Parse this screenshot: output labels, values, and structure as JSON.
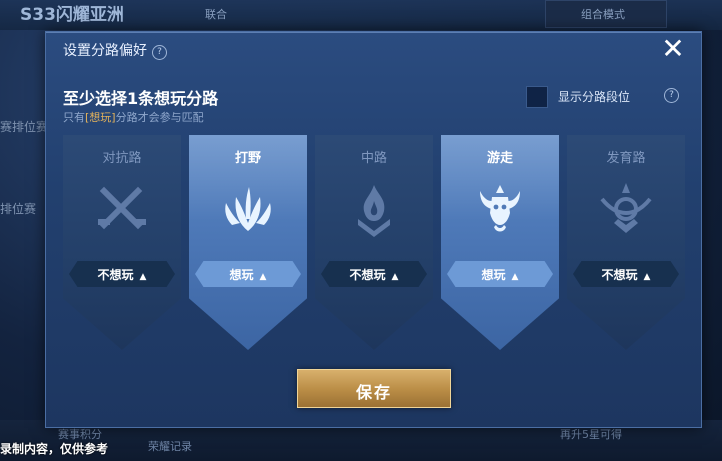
{
  "background": {
    "season_title": "S33闪耀亚洲",
    "tag": "联合",
    "left_labels": [
      "赛排位赛",
      "排位赛"
    ],
    "bottom_items": [
      "赛事积分",
      "荣耀记录",
      "再升5星可得"
    ],
    "right_panel": "组合模式"
  },
  "watermark": "录制内容，仅供参考",
  "dialog": {
    "title": "设置分路偏好",
    "close_icon": "close-icon",
    "heading": "至少选择1条想玩分路",
    "subline_prefix": "只有",
    "subline_highlight": "[想玩]",
    "subline_suffix": "分路才会参与匹配",
    "toggle_label": "显示分路段位",
    "lanes": [
      {
        "name": "对抗路",
        "icon": "crossed-swords-icon",
        "selected": false,
        "button_label": "不想玩"
      },
      {
        "name": "打野",
        "icon": "claw-plant-icon",
        "selected": true,
        "button_label": "想玩"
      },
      {
        "name": "中路",
        "icon": "flame-icon",
        "selected": false,
        "button_label": "不想玩"
      },
      {
        "name": "游走",
        "icon": "tusk-mask-icon",
        "selected": true,
        "button_label": "想玩"
      },
      {
        "name": "发育路",
        "icon": "bow-crest-icon",
        "selected": false,
        "button_label": "不想玩"
      }
    ],
    "save_label": "保存"
  }
}
